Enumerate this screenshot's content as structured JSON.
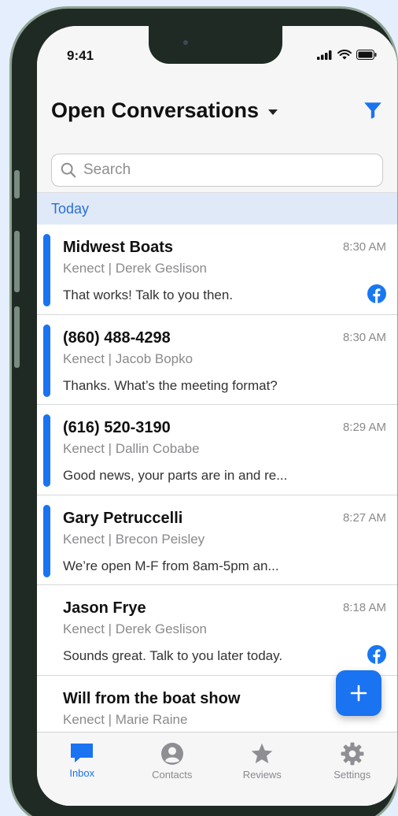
{
  "status": {
    "time": "9:41"
  },
  "header": {
    "title": "Open Conversations",
    "search_placeholder": "Search"
  },
  "section": {
    "label": "Today"
  },
  "conversations": [
    {
      "name": "Midwest Boats",
      "sub": "Kenect | Derek Geslison",
      "time": "8:30 AM",
      "message": "That works! Talk to you then.",
      "unread": true,
      "facebook": true
    },
    {
      "name": "(860) 488-4298",
      "sub": "Kenect | Jacob Bopko",
      "time": "8:30 AM",
      "message": "Thanks. What’s the meeting format?",
      "unread": true,
      "facebook": false
    },
    {
      "name": "(616) 520-3190",
      "sub": "Kenect | Dallin Cobabe",
      "time": "8:29 AM",
      "message": "Good news, your parts are in and re...",
      "unread": true,
      "facebook": false
    },
    {
      "name": "Gary Petruccelli",
      "sub": "Kenect | Brecon Peisley",
      "time": "8:27 AM",
      "message": "We’re open M-F from 8am-5pm an...",
      "unread": true,
      "facebook": false
    },
    {
      "name": "Jason Frye",
      "sub": "Kenect | Derek Geslison",
      "time": "8:18 AM",
      "message": "Sounds great. Talk to you later today.",
      "unread": false,
      "facebook": true
    },
    {
      "name": "Will from the boat show",
      "sub": "Kenect | Marie Raine",
      "time": "",
      "message": "",
      "unread": false,
      "facebook": false
    }
  ],
  "tabs": [
    {
      "label": "Inbox",
      "icon": "inbox-icon",
      "active": true
    },
    {
      "label": "Contacts",
      "icon": "contact-icon",
      "active": false
    },
    {
      "label": "Reviews",
      "icon": "star-icon",
      "active": false
    },
    {
      "label": "Settings",
      "icon": "gear-icon",
      "active": false
    }
  ],
  "colors": {
    "accent": "#1a73f0",
    "section_bg": "#dfe9f8",
    "facebook": "#1877f2"
  }
}
